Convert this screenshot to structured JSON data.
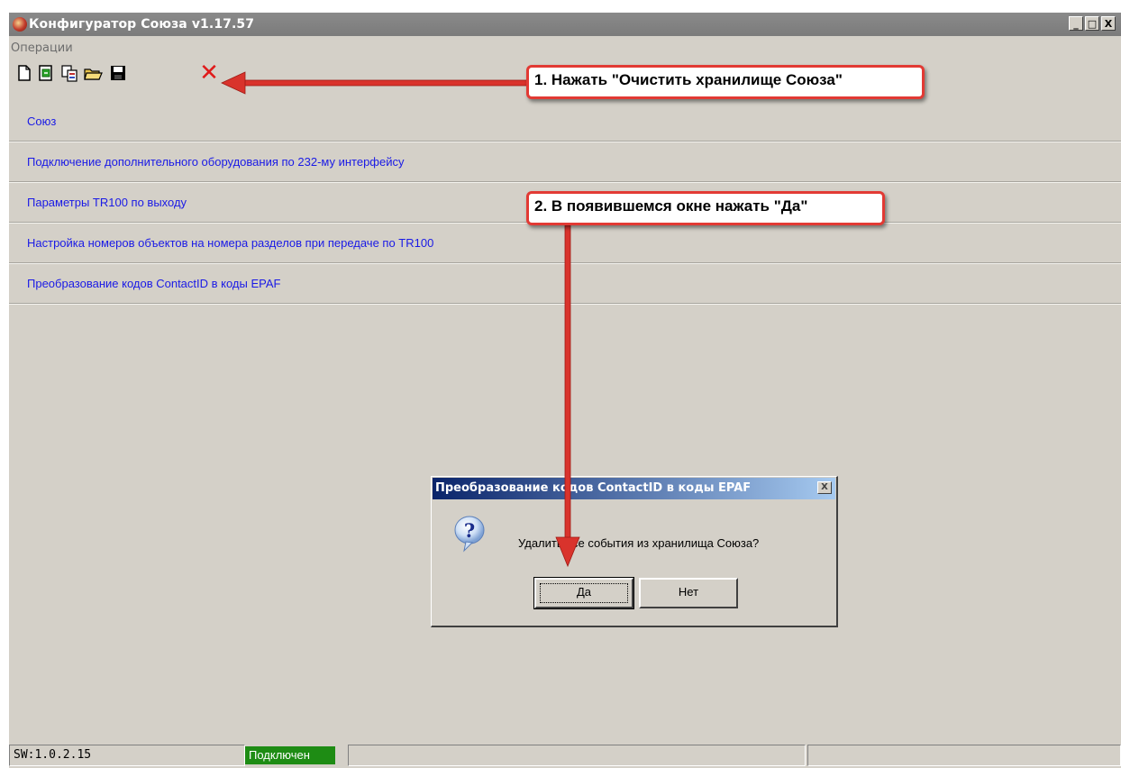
{
  "window": {
    "title": "Конфигуратор Союза v1.17.57",
    "controls": {
      "minimize": "_",
      "maximize": "□",
      "close": "X"
    }
  },
  "menu": {
    "items": [
      "Операции"
    ]
  },
  "toolbar": {
    "icons": [
      "new-file-icon",
      "import-icon",
      "copy-icon",
      "open-folder-icon",
      "save-icon",
      "clear-storage-icon"
    ],
    "clear_symbol": "✕"
  },
  "sections": [
    "Союз",
    "Подключение дополнительного оборудования по 232-му интерфейсу",
    "Параметры TR100 по выходу",
    "Настройка номеров объектов на номера разделов при передаче по TR100",
    "Преобразование кодов ContactID в коды EPAF"
  ],
  "callouts": [
    "1. Нажать \"Очистить хранилище Союза\"",
    "2. В появившемся окне нажать \"Да\""
  ],
  "dialog": {
    "title": "Преобразование кодов ContactID в коды EPAF",
    "close": "X",
    "message": "Удалить все события из хранилища Союза?",
    "icon": "question-icon",
    "yes_label": "Да",
    "no_label": "Нет"
  },
  "statusbar": {
    "sw_version": "SW:1.0.2.15",
    "connection_status": "Подключен"
  },
  "colors": {
    "window_bg": "#d4d0c8",
    "link": "#1a1ae6",
    "annotation": "#e23a34",
    "status_connected": "#1e8c14"
  }
}
